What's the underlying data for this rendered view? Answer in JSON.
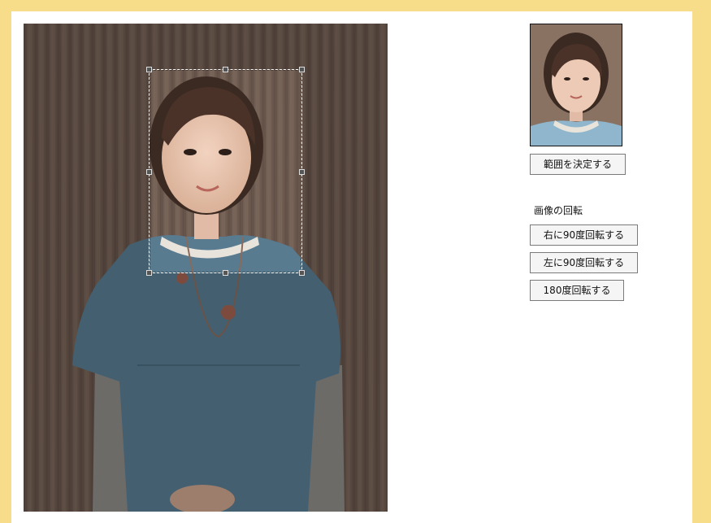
{
  "crop_panel": {
    "decide_button": "範囲を決定する"
  },
  "rotate": {
    "heading": "画像の回転",
    "right90": "右に90度回転する",
    "left90": "左に90度回転する",
    "r180": "180度回転する"
  },
  "colors": {
    "frame": "#f7dc8a",
    "wall": "#6d5a4f",
    "dress": "#5a7e94"
  }
}
